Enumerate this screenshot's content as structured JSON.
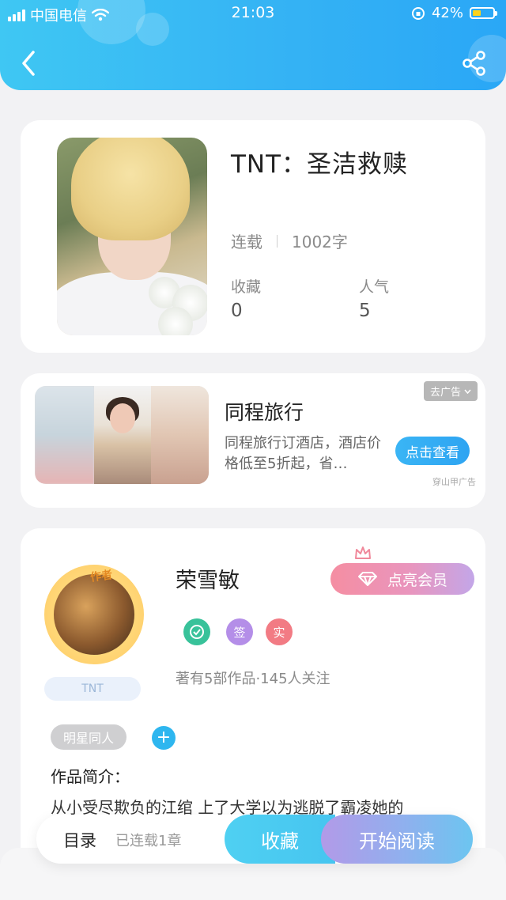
{
  "status_bar": {
    "carrier": "中国电信",
    "time": "21:03",
    "battery": "42%",
    "battery_level": 0.42
  },
  "header": {
    "back_icon": "chevron-left-icon",
    "share_icon": "share-icon"
  },
  "book": {
    "title": "TNT：圣洁救赎",
    "status": "连载",
    "word_count": "1002字",
    "favorites_label": "收藏",
    "favorites_value": "0",
    "popularity_label": "人气",
    "popularity_value": "5"
  },
  "ad": {
    "title": "同程旅行",
    "description": "同程旅行订酒店，酒店价格低至5折起，省…",
    "close_label": "去广告",
    "cta_label": "点击查看",
    "source": "穿山甲广告"
  },
  "author": {
    "tag": "作者",
    "name": "荣雪敏",
    "badge": "TNT",
    "vip_button": "点亮会员",
    "badges": [
      "签",
      "实"
    ],
    "stats": "著有5部作品·145人关注",
    "genre_tag": "明星同人",
    "add_tag": "+",
    "intro_heading": "作品简介：",
    "intro_text": "从小受尽欺负的江绾  上了大学以为逃脱了霸凌她的"
  },
  "bottom_bar": {
    "toc_label": "目录",
    "chapter_count": "已连载1章",
    "favorite_button": "收藏",
    "read_button": "开始阅读"
  },
  "colors": {
    "header_start": "#3fc7f3",
    "header_end": "#2aa7f6",
    "accent_blue": "#2eb6ef",
    "vip_pink": "#f58ea2",
    "badge_green": "#38c29a",
    "badge_purple": "#b48ee8",
    "badge_red": "#f27b84"
  }
}
